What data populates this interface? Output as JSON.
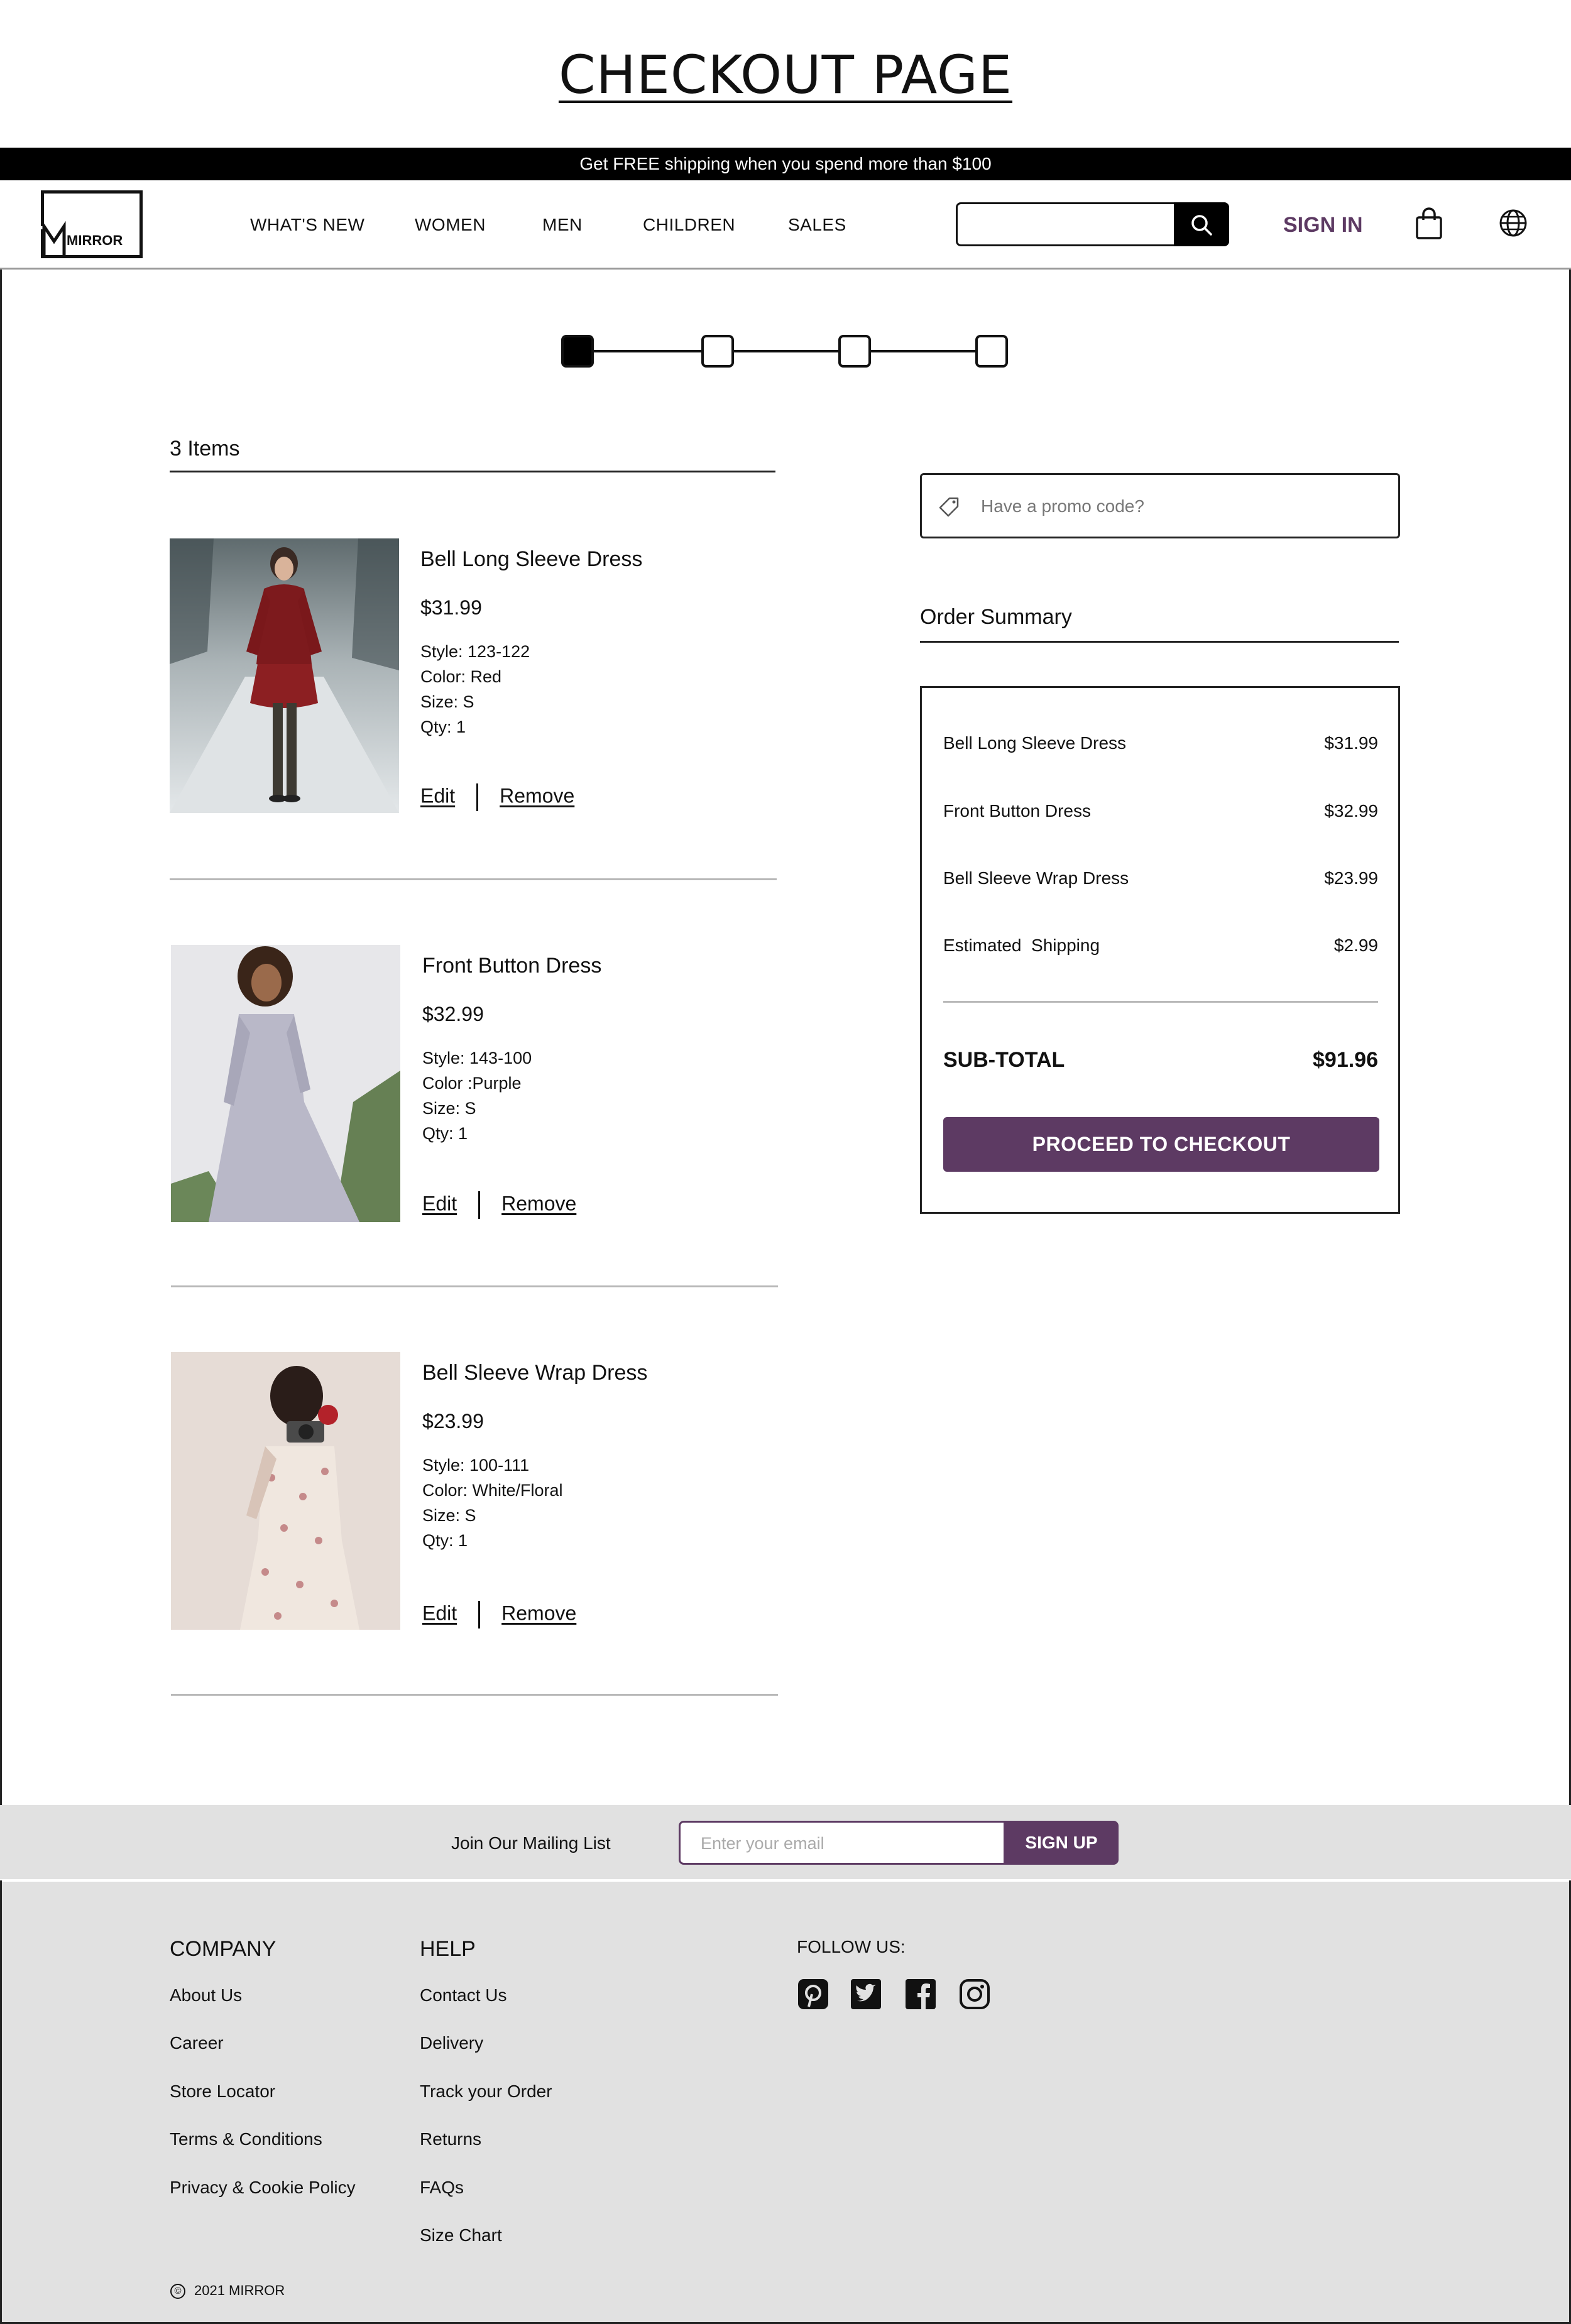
{
  "page_title": "CHECKOUT PAGE",
  "promo_banner": "Get FREE shipping when you spend more than $100",
  "header": {
    "logo_text": "MIRROR",
    "nav": [
      "WHAT'S NEW",
      "WOMEN",
      "MEN",
      "CHILDREN",
      "SALES"
    ],
    "search_placeholder": "",
    "sign_in": "SIGN IN",
    "icons": [
      "search-icon",
      "shopping-bag-icon",
      "globe-icon"
    ]
  },
  "stepper": {
    "total_steps": 4,
    "current_step": 1
  },
  "cart": {
    "items_count": "3 Items",
    "items": [
      {
        "name": "Bell Long Sleeve Dress",
        "price": "$31.99",
        "style": "Style: 123-122",
        "color": "Color: Red",
        "size": "Size: S",
        "qty": "Qty: 1",
        "edit": "Edit",
        "remove": "Remove"
      },
      {
        "name": "Front Button Dress",
        "price": "$32.99",
        "style": "Style: 143-100",
        "color": "Color :Purple",
        "size": "Size: S",
        "qty": "Qty: 1",
        "edit": "Edit",
        "remove": "Remove"
      },
      {
        "name": "Bell Sleeve Wrap Dress",
        "price": "$23.99",
        "style": "Style: 100-111",
        "color": "Color: White/Floral",
        "size": "Size: S",
        "qty": "Qty: 1",
        "edit": "Edit",
        "remove": "Remove"
      }
    ]
  },
  "promo_code": {
    "placeholder": "Have a promo code?"
  },
  "order_summary": {
    "title": "Order Summary",
    "rows": [
      {
        "label": "Bell Long Sleeve Dress",
        "amount": "$31.99"
      },
      {
        "label": "Front Button Dress",
        "amount": "$32.99"
      },
      {
        "label": "Bell Sleeve Wrap Dress",
        "amount": "$23.99"
      },
      {
        "label": "Estimated  Shipping",
        "amount": "$2.99"
      }
    ],
    "subtotal_label": "SUB-TOTAL",
    "subtotal_amount": "$91.96",
    "checkout_button": "PROCEED TO CHECKOUT"
  },
  "mailing": {
    "label": "Join Our Mailing List",
    "placeholder": "Enter your email",
    "button": "SIGN UP"
  },
  "footer": {
    "company": {
      "title": "COMPANY",
      "links": [
        "About Us",
        "Career",
        "Store Locator",
        "Terms & Conditions",
        "Privacy & Cookie Policy"
      ]
    },
    "help": {
      "title": "HELP",
      "links": [
        "Contact Us",
        "Delivery",
        "Track your Order",
        "Returns",
        "FAQs",
        "Size Chart"
      ]
    },
    "follow": {
      "title": "FOLLOW US:",
      "icons": [
        "pinterest-icon",
        "twitter-icon",
        "facebook-icon",
        "instagram-icon"
      ]
    },
    "copyright": "2021 MIRROR",
    "copyright_symbol": "©"
  },
  "colors": {
    "accent": "#5d3a63",
    "footer_bg": "#e1e1e1",
    "black": "#000000"
  }
}
